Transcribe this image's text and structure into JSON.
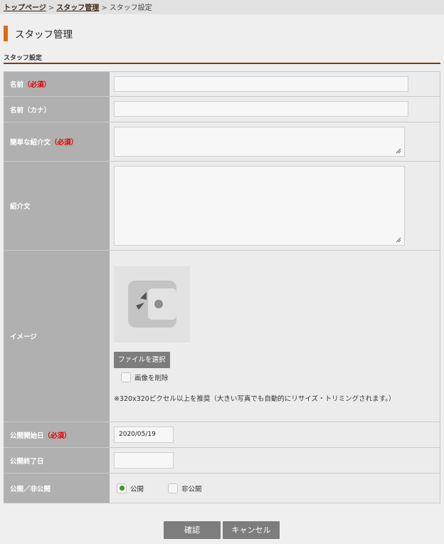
{
  "breadcrumb": {
    "home": "トップページ",
    "staff": "スタッフ管理",
    "current": "スタッフ設定",
    "sep": ">"
  },
  "page_title": "スタッフ管理",
  "section_title": "スタッフ設定",
  "required_mark": "（必須）",
  "fields": {
    "name": {
      "label": "名前",
      "value": ""
    },
    "name_kana": {
      "label": "名前（カナ）",
      "value": ""
    },
    "short_intro": {
      "label": "簡単な紹介文",
      "value": ""
    },
    "intro": {
      "label": "紹介文",
      "value": ""
    },
    "image": {
      "label": "イメージ",
      "file_button": "ファイルを選択",
      "delete_label": "画像を削除",
      "delete_checked": false,
      "note": "※320x320ピクセル以上を推奨（大きい写真でも自動的にリサイズ・トリミングされます。）"
    },
    "publish_start": {
      "label": "公開開始日",
      "value": "2020/05/19"
    },
    "publish_end": {
      "label": "公開終了日",
      "value": ""
    },
    "visibility": {
      "label": "公開／非公開",
      "options": [
        "公開",
        "非公開"
      ],
      "selected": "公開"
    }
  },
  "buttons": {
    "confirm": "確認",
    "cancel": "キャンセル"
  },
  "colors": {
    "accent": "#e06a0c",
    "section_line": "#7a3c14",
    "required": "#e00000",
    "radio_selected": "#3c9a20",
    "label_bg": "#b0b0b0",
    "button_bg": "#7d7d7d"
  }
}
